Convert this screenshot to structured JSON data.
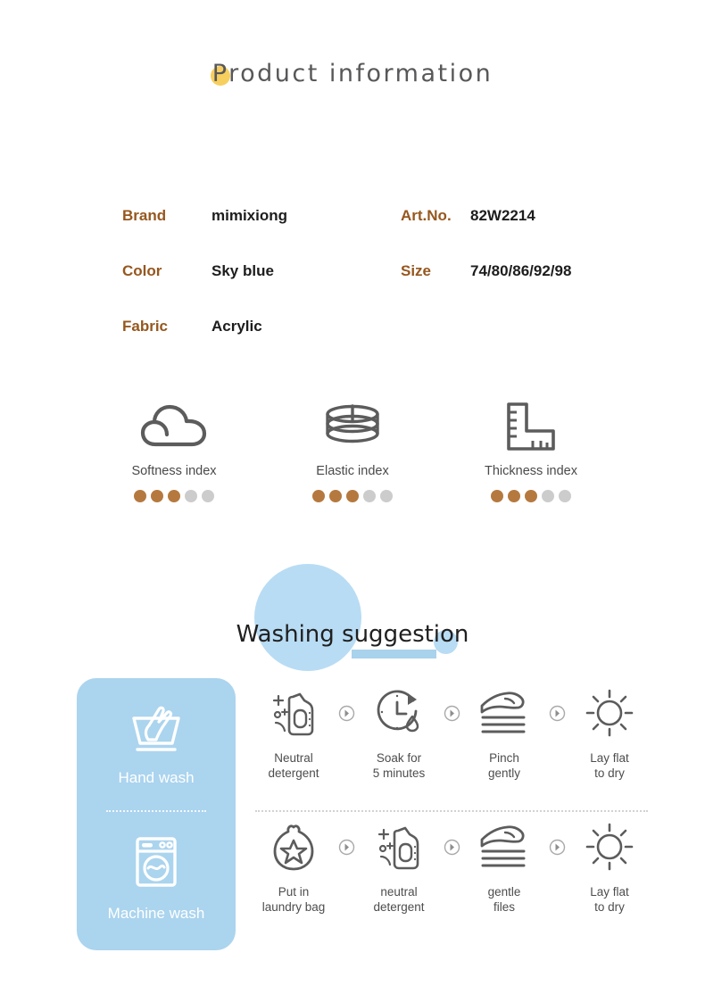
{
  "header": {
    "title": "Product information",
    "accent_dot_color": "#f7cf5e"
  },
  "specs": {
    "rows": [
      {
        "label": "Brand",
        "value": "mimixiong",
        "label2": "Art.No.",
        "value2": "82W2214"
      },
      {
        "label": "Color",
        "value": "Sky blue",
        "label2": "Size",
        "value2": "74/80/86/92/98"
      },
      {
        "label": "Fabric",
        "value": "Acrylic",
        "label2": "",
        "value2": ""
      }
    ],
    "label_color": "#96571e",
    "value_color": "#1d1d1d"
  },
  "indexes": {
    "filled_color": "#b5793f",
    "empty_color": "#cccccc",
    "total_dots": 5,
    "items": [
      {
        "icon": "cloud-icon",
        "label": "Softness index",
        "rating": 3
      },
      {
        "icon": "spring-coil-icon",
        "label": "Elastic index",
        "rating": 3
      },
      {
        "icon": "ruler-square-icon",
        "label": "Thickness index",
        "rating": 3
      }
    ]
  },
  "washing": {
    "heading": "Washing suggestion",
    "blob_color": "#b8dcf4",
    "underline_color": "#a9d2ec",
    "panel_color": "#abd4ee",
    "modes": [
      {
        "icon": "hand-wash-icon",
        "label": "Hand wash"
      },
      {
        "icon": "machine-wash-icon",
        "label": "Machine wash"
      }
    ],
    "rows": [
      {
        "steps": [
          {
            "icon": "detergent-bottle-icon",
            "line1": "Neutral",
            "line2": "detergent"
          },
          {
            "icon": "clock-soak-icon",
            "line1": "Soak for",
            "line2": "5 minutes"
          },
          {
            "icon": "hand-pinch-icon",
            "line1": "Pinch",
            "line2": "gently"
          },
          {
            "icon": "sun-dry-icon",
            "line1": "Lay flat",
            "line2": "to dry"
          }
        ]
      },
      {
        "steps": [
          {
            "icon": "laundry-bag-icon",
            "line1": "Put in",
            "line2": "laundry bag"
          },
          {
            "icon": "detergent-bottle-icon",
            "line1": "neutral",
            "line2": "detergent"
          },
          {
            "icon": "hand-pinch-icon",
            "line1": "gentle",
            "line2": "files"
          },
          {
            "icon": "sun-dry-icon",
            "line1": "Lay flat",
            "line2": "to dry"
          }
        ]
      }
    ],
    "separator_icon": "circle-chevron-right-icon"
  }
}
